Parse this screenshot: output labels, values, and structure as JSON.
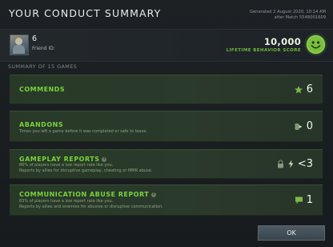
{
  "window": {
    "title": "YOUR CONDUCT SUMMARY"
  },
  "meta": {
    "generated": "Generated 2 August 2020, 10:14 AM",
    "after_match": "after Match 5548001609"
  },
  "profile": {
    "player_name": "6",
    "friend_id_label": "Friend ID:",
    "score_value": "10,000",
    "score_label": "LIFETIME BEHAVIOR SCORE",
    "score_icon": "smiley-face-icon"
  },
  "summary": {
    "label": "SUMMARY OF 15 GAMES"
  },
  "cards": [
    {
      "title": "COMMENDS",
      "has_info": false,
      "desc_lines": [],
      "icon": "commend-star-icon",
      "value": "6"
    },
    {
      "title": "ABANDONS",
      "has_info": false,
      "desc_lines": [
        "Times you left a game before it was completed or safe to leave."
      ],
      "icon": "abandon-icon",
      "value": "0"
    },
    {
      "title": "GAMEPLAY REPORTS",
      "has_info": true,
      "desc_lines": [
        "86% of players have a low report rate like you.",
        "Reports by allies for disruptive gameplay, cheating or MMR abuse."
      ],
      "icon": "lock-flag-icon",
      "value": "<3"
    },
    {
      "title": "COMMUNICATION ABUSE REPORT",
      "has_info": true,
      "desc_lines": [
        "83% of players have a low report rate like you.",
        "Reports by allies and enemies for abusive or disruptive communication."
      ],
      "icon": "chat-bubble-icon",
      "value": "1"
    }
  ],
  "actions": {
    "ok_label": "OK"
  },
  "colors": {
    "accent_green": "#79d23c",
    "card_bg": "#2a3a2b",
    "background": "#1b1e20"
  }
}
